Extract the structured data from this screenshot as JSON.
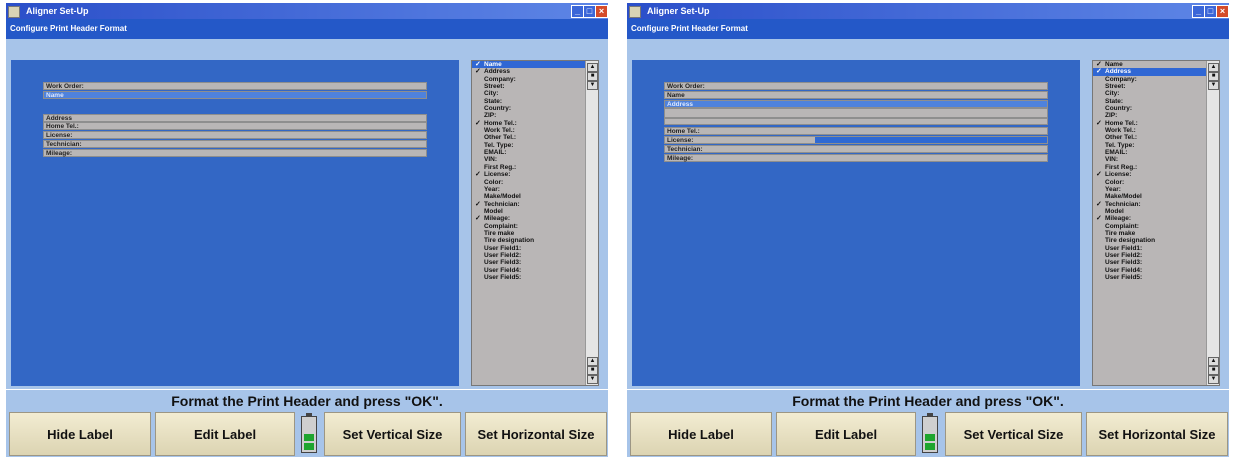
{
  "colors": {
    "titlebar": "#2b4fc9",
    "subtitle_bar": "#2458c8",
    "work_area": "#a7c4e9",
    "blue_panel": "#3367c5",
    "selection": "#3067d4",
    "button": "#e8e1c4",
    "battery_level": "#1ea52e"
  },
  "screens": [
    {
      "title": "Aligner Set-Up",
      "subtitle": "Configure Print Header Format",
      "fields": [
        {
          "label": "Work Order:",
          "selected": false,
          "fill_fraction": 0
        },
        {
          "label": "Name",
          "selected": true,
          "fill_fraction": 0
        },
        {
          "label": "",
          "selected": false,
          "fill_fraction": 0
        },
        {
          "label": "Address",
          "selected": false,
          "fill_fraction": 0
        },
        {
          "label": "Home Tel.:",
          "selected": false,
          "fill_fraction": 0
        },
        {
          "label": "License:",
          "selected": false,
          "fill_fraction": 0
        },
        {
          "label": "Technician:",
          "selected": false,
          "fill_fraction": 0
        },
        {
          "label": "Mileage:",
          "selected": false,
          "fill_fraction": 0
        }
      ],
      "list": [
        {
          "label": "Name",
          "checked": true,
          "selected": true
        },
        {
          "label": "Address",
          "checked": true,
          "selected": false
        },
        {
          "label": "Company:",
          "checked": false,
          "selected": false
        },
        {
          "label": "Street:",
          "checked": false,
          "selected": false
        },
        {
          "label": "City:",
          "checked": false,
          "selected": false
        },
        {
          "label": "State:",
          "checked": false,
          "selected": false
        },
        {
          "label": "Country:",
          "checked": false,
          "selected": false
        },
        {
          "label": "ZIP:",
          "checked": false,
          "selected": false
        },
        {
          "label": "Home Tel.:",
          "checked": true,
          "selected": false
        },
        {
          "label": "Work Tel.:",
          "checked": false,
          "selected": false
        },
        {
          "label": "Other Tel.:",
          "checked": false,
          "selected": false
        },
        {
          "label": "Tel. Type:",
          "checked": false,
          "selected": false
        },
        {
          "label": "EMAIL:",
          "checked": false,
          "selected": false
        },
        {
          "label": "VIN:",
          "checked": false,
          "selected": false
        },
        {
          "label": "First Reg.:",
          "checked": false,
          "selected": false
        },
        {
          "label": "License:",
          "checked": true,
          "selected": false
        },
        {
          "label": "Color:",
          "checked": false,
          "selected": false
        },
        {
          "label": "Year:",
          "checked": false,
          "selected": false
        },
        {
          "label": "Make/Model",
          "checked": false,
          "selected": false
        },
        {
          "label": "Technician:",
          "checked": true,
          "selected": false
        },
        {
          "label": "Model",
          "checked": false,
          "selected": false
        },
        {
          "label": "Mileage:",
          "checked": true,
          "selected": false
        },
        {
          "label": "Complaint:",
          "checked": false,
          "selected": false
        },
        {
          "label": "Tire make",
          "checked": false,
          "selected": false
        },
        {
          "label": "Tire designation",
          "checked": false,
          "selected": false
        },
        {
          "label": "User Field1:",
          "checked": false,
          "selected": false
        },
        {
          "label": "User Field2:",
          "checked": false,
          "selected": false
        },
        {
          "label": "User Field3:",
          "checked": false,
          "selected": false
        },
        {
          "label": "User Field4:",
          "checked": false,
          "selected": false
        },
        {
          "label": "User Field5:",
          "checked": false,
          "selected": false
        }
      ],
      "status": "Format the Print Header and press \"OK\".",
      "buttons": {
        "hide_label": "Hide Label",
        "edit_label": "Edit Label",
        "set_vertical": "Set Vertical Size",
        "set_horizontal": "Set Horizontal Size"
      },
      "battery_level": 0.66
    },
    {
      "title": "Aligner Set-Up",
      "subtitle": "Configure Print Header Format",
      "fields": [
        {
          "label": "Work Order:",
          "selected": false,
          "fill_fraction": 0
        },
        {
          "label": "Name",
          "selected": false,
          "fill_fraction": 0
        },
        {
          "label": "Address",
          "selected": true,
          "fill_fraction": 0
        },
        {
          "label": "",
          "selected": false,
          "fill_fraction": 0
        },
        {
          "label": "",
          "selected": false,
          "fill_fraction": 0
        },
        {
          "label": "Home Tel.:",
          "selected": false,
          "fill_fraction": 0
        },
        {
          "label": "License:",
          "selected": false,
          "fill_fraction": 0.61
        },
        {
          "label": "Technician:",
          "selected": false,
          "fill_fraction": 0
        },
        {
          "label": "Mileage:",
          "selected": false,
          "fill_fraction": 0
        }
      ],
      "list": [
        {
          "label": "Name",
          "checked": true,
          "selected": false
        },
        {
          "label": "Address",
          "checked": true,
          "selected": true
        },
        {
          "label": "Company:",
          "checked": false,
          "selected": false
        },
        {
          "label": "Street:",
          "checked": false,
          "selected": false
        },
        {
          "label": "City:",
          "checked": false,
          "selected": false
        },
        {
          "label": "State:",
          "checked": false,
          "selected": false
        },
        {
          "label": "Country:",
          "checked": false,
          "selected": false
        },
        {
          "label": "ZIP:",
          "checked": false,
          "selected": false
        },
        {
          "label": "Home Tel.:",
          "checked": true,
          "selected": false
        },
        {
          "label": "Work Tel.:",
          "checked": false,
          "selected": false
        },
        {
          "label": "Other Tel.:",
          "checked": false,
          "selected": false
        },
        {
          "label": "Tel. Type:",
          "checked": false,
          "selected": false
        },
        {
          "label": "EMAIL:",
          "checked": false,
          "selected": false
        },
        {
          "label": "VIN:",
          "checked": false,
          "selected": false
        },
        {
          "label": "First Reg.:",
          "checked": false,
          "selected": false
        },
        {
          "label": "License:",
          "checked": true,
          "selected": false
        },
        {
          "label": "Color:",
          "checked": false,
          "selected": false
        },
        {
          "label": "Year:",
          "checked": false,
          "selected": false
        },
        {
          "label": "Make/Model",
          "checked": false,
          "selected": false
        },
        {
          "label": "Technician:",
          "checked": true,
          "selected": false
        },
        {
          "label": "Model",
          "checked": false,
          "selected": false
        },
        {
          "label": "Mileage:",
          "checked": true,
          "selected": false
        },
        {
          "label": "Complaint:",
          "checked": false,
          "selected": false
        },
        {
          "label": "Tire make",
          "checked": false,
          "selected": false
        },
        {
          "label": "Tire designation",
          "checked": false,
          "selected": false
        },
        {
          "label": "User Field1:",
          "checked": false,
          "selected": false
        },
        {
          "label": "User Field2:",
          "checked": false,
          "selected": false
        },
        {
          "label": "User Field3:",
          "checked": false,
          "selected": false
        },
        {
          "label": "User Field4:",
          "checked": false,
          "selected": false
        },
        {
          "label": "User Field5:",
          "checked": false,
          "selected": false
        }
      ],
      "status": "Format the Print Header and press \"OK\".",
      "buttons": {
        "hide_label": "Hide Label",
        "edit_label": "Edit Label",
        "set_vertical": "Set Vertical Size",
        "set_horizontal": "Set Horizontal Size"
      },
      "battery_level": 0.66
    }
  ]
}
